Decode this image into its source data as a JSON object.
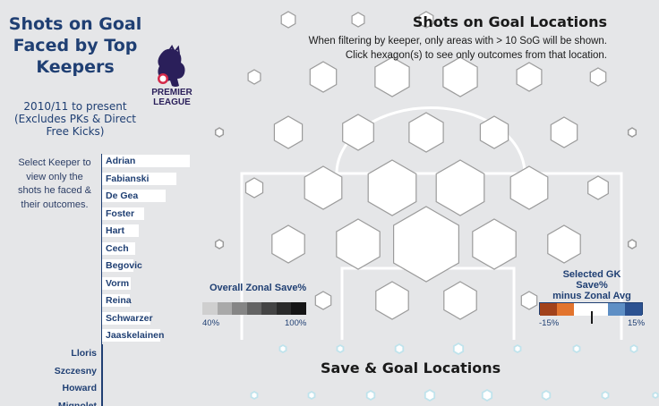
{
  "left_panel": {
    "title": "Shots on Goal Faced by Top Keepers",
    "subtitle": "2010/11 to present (Excludes PKs & Direct Free Kicks)",
    "logo_text_1": "PREMIER",
    "logo_text_2": "LEAGUE",
    "keeper_hint": "Select Keeper to view only the shots he faced & their outcomes."
  },
  "keepers": [
    {
      "name": "Adrian",
      "bar_fraction": 1.0
    },
    {
      "name": "Fabianski",
      "bar_fraction": 0.85
    },
    {
      "name": "De Gea",
      "bar_fraction": 0.72
    },
    {
      "name": "Foster",
      "bar_fraction": 0.48
    },
    {
      "name": "Hart",
      "bar_fraction": 0.42
    },
    {
      "name": "Cech",
      "bar_fraction": 0.38
    },
    {
      "name": "Begovic",
      "bar_fraction": 0.36
    },
    {
      "name": "Vorm",
      "bar_fraction": 0.33
    },
    {
      "name": "Reina",
      "bar_fraction": 0.32
    },
    {
      "name": "Schwarzer",
      "bar_fraction": 0.55
    },
    {
      "name": "Jaaskelainen",
      "bar_fraction": 0.66
    }
  ],
  "keepers_more": [
    "Lloris",
    "Szczesny",
    "Howard",
    "Mignolet"
  ],
  "right_header": {
    "title": "Shots on Goal Locations",
    "desc_line1": "When filtering by keeper, only areas with > 10 SoG will be shown.",
    "desc_line2": "Click hexagon(s) to see only outcomes from that location."
  },
  "legend_overall": {
    "title": "Overall Zonal Save%",
    "min_label": "40%",
    "max_label": "100%",
    "colors": [
      "#cfcfcf",
      "#a9a9a9",
      "#858585",
      "#636363",
      "#444444",
      "#2a2a2a",
      "#151515"
    ]
  },
  "legend_selected": {
    "title_line1": "Selected GK Save%",
    "title_line2": "minus Zonal Avg",
    "min_label": "-15%",
    "max_label": "15%",
    "colors": [
      "#a2421b",
      "#e2742e",
      "#ffffff",
      "#ffffff",
      "#5e8fc5",
      "#2c5291"
    ]
  },
  "bottom": {
    "title": "Save & Goal Locations"
  },
  "colors": {
    "brand": "#1f3f73",
    "hex_stroke": "#9b9b9b",
    "goal_hex": "#bfe3ec"
  }
}
